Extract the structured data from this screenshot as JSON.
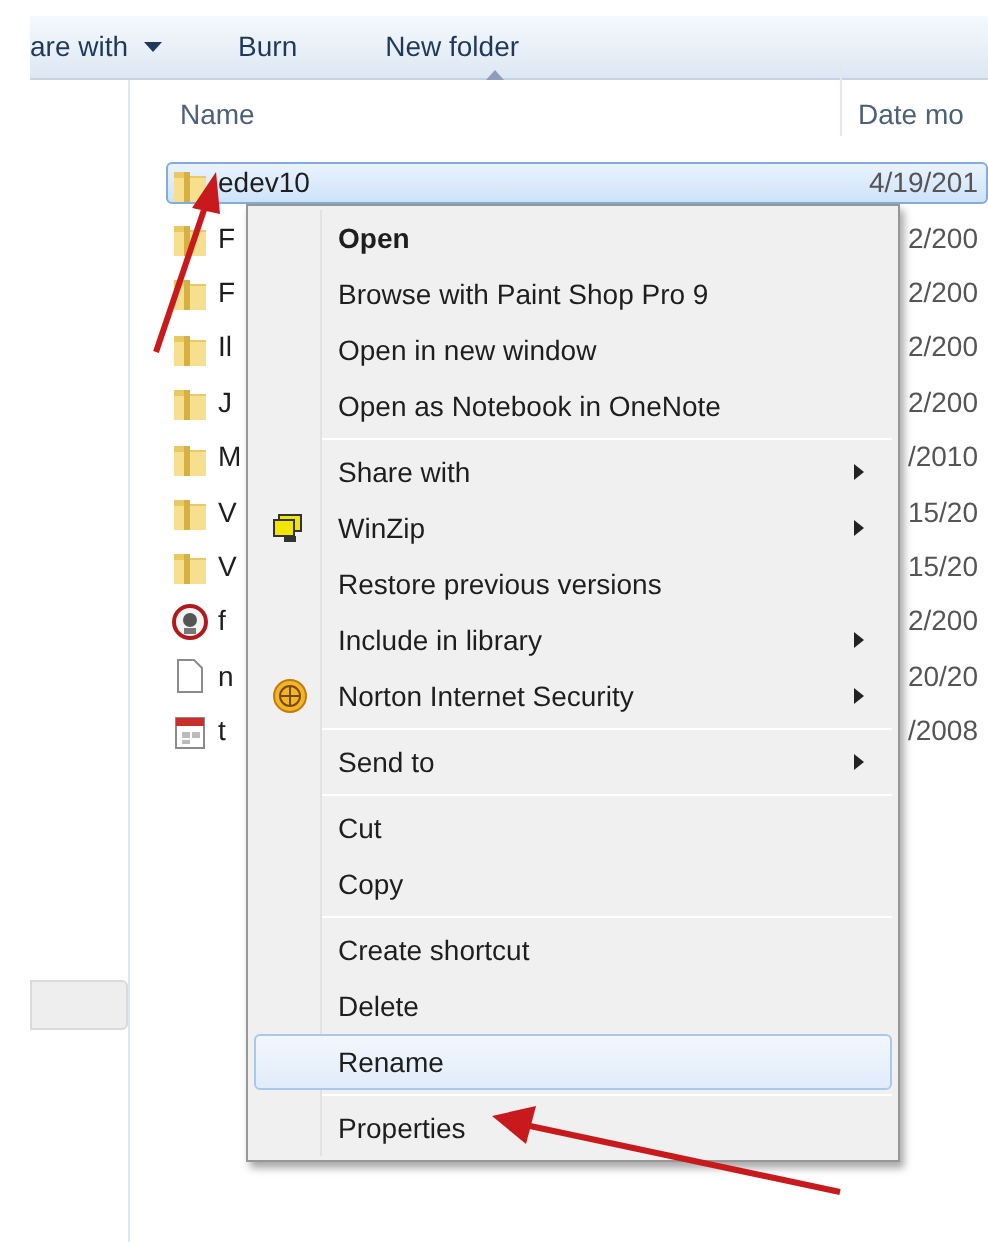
{
  "toolbar": {
    "items": [
      {
        "label": "are with",
        "dropdown": true
      },
      {
        "label": "Burn",
        "dropdown": false
      },
      {
        "label": "New folder",
        "dropdown": false
      }
    ]
  },
  "columns": [
    {
      "label": "Name",
      "sorted": true
    },
    {
      "label": "Date mo",
      "sorted": false
    }
  ],
  "files": [
    {
      "name": "edev10",
      "date": "4/19/201",
      "kind": "folder",
      "selected": true
    },
    {
      "name": "F",
      "date": "2/200",
      "kind": "folder",
      "selected": false
    },
    {
      "name": "F",
      "date": "2/200",
      "kind": "folder",
      "selected": false
    },
    {
      "name": "Il",
      "date": "2/200",
      "kind": "folder",
      "selected": false
    },
    {
      "name": "J",
      "date": "2/200",
      "kind": "folder",
      "selected": false
    },
    {
      "name": "M",
      "date": "/2010",
      "kind": "folder",
      "selected": false
    },
    {
      "name": "V",
      "date": "15/20",
      "kind": "folder",
      "selected": false
    },
    {
      "name": "V",
      "date": "15/20",
      "kind": "folder",
      "selected": false
    },
    {
      "name": "f",
      "date": "2/200",
      "kind": "app",
      "selected": false
    },
    {
      "name": "n",
      "date": "20/20",
      "kind": "blank",
      "selected": false
    },
    {
      "name": "t",
      "date": "/2008",
      "kind": "calendar",
      "selected": false
    }
  ],
  "context_menu": {
    "groups": [
      [
        {
          "label": "Open",
          "default": true,
          "submenu": false,
          "selected": false
        },
        {
          "label": "Browse with Paint Shop Pro 9",
          "submenu": false,
          "selected": false
        },
        {
          "label": "Open in new window",
          "submenu": false,
          "selected": false
        },
        {
          "label": "Open as Notebook in OneNote",
          "submenu": false,
          "selected": false
        }
      ],
      [
        {
          "label": "Share with",
          "submenu": true,
          "selected": false
        },
        {
          "label": "WinZip",
          "kind": "computer",
          "submenu": true,
          "selected": false
        },
        {
          "label": "Restore previous versions",
          "submenu": false,
          "selected": false
        },
        {
          "label": "Include in library",
          "submenu": true,
          "selected": false
        },
        {
          "label": "Norton Internet Security",
          "kind": "globe",
          "submenu": true,
          "selected": false
        }
      ],
      [
        {
          "label": "Send to",
          "submenu": true,
          "selected": false
        }
      ],
      [
        {
          "label": "Cut",
          "submenu": false,
          "selected": false
        },
        {
          "label": "Copy",
          "submenu": false,
          "selected": false
        }
      ],
      [
        {
          "label": "Create shortcut",
          "submenu": false,
          "selected": false
        },
        {
          "label": "Delete",
          "submenu": false,
          "selected": false
        },
        {
          "label": "Rename",
          "submenu": false,
          "selected": true
        }
      ],
      [
        {
          "label": "Properties",
          "submenu": false,
          "selected": false
        }
      ]
    ]
  }
}
